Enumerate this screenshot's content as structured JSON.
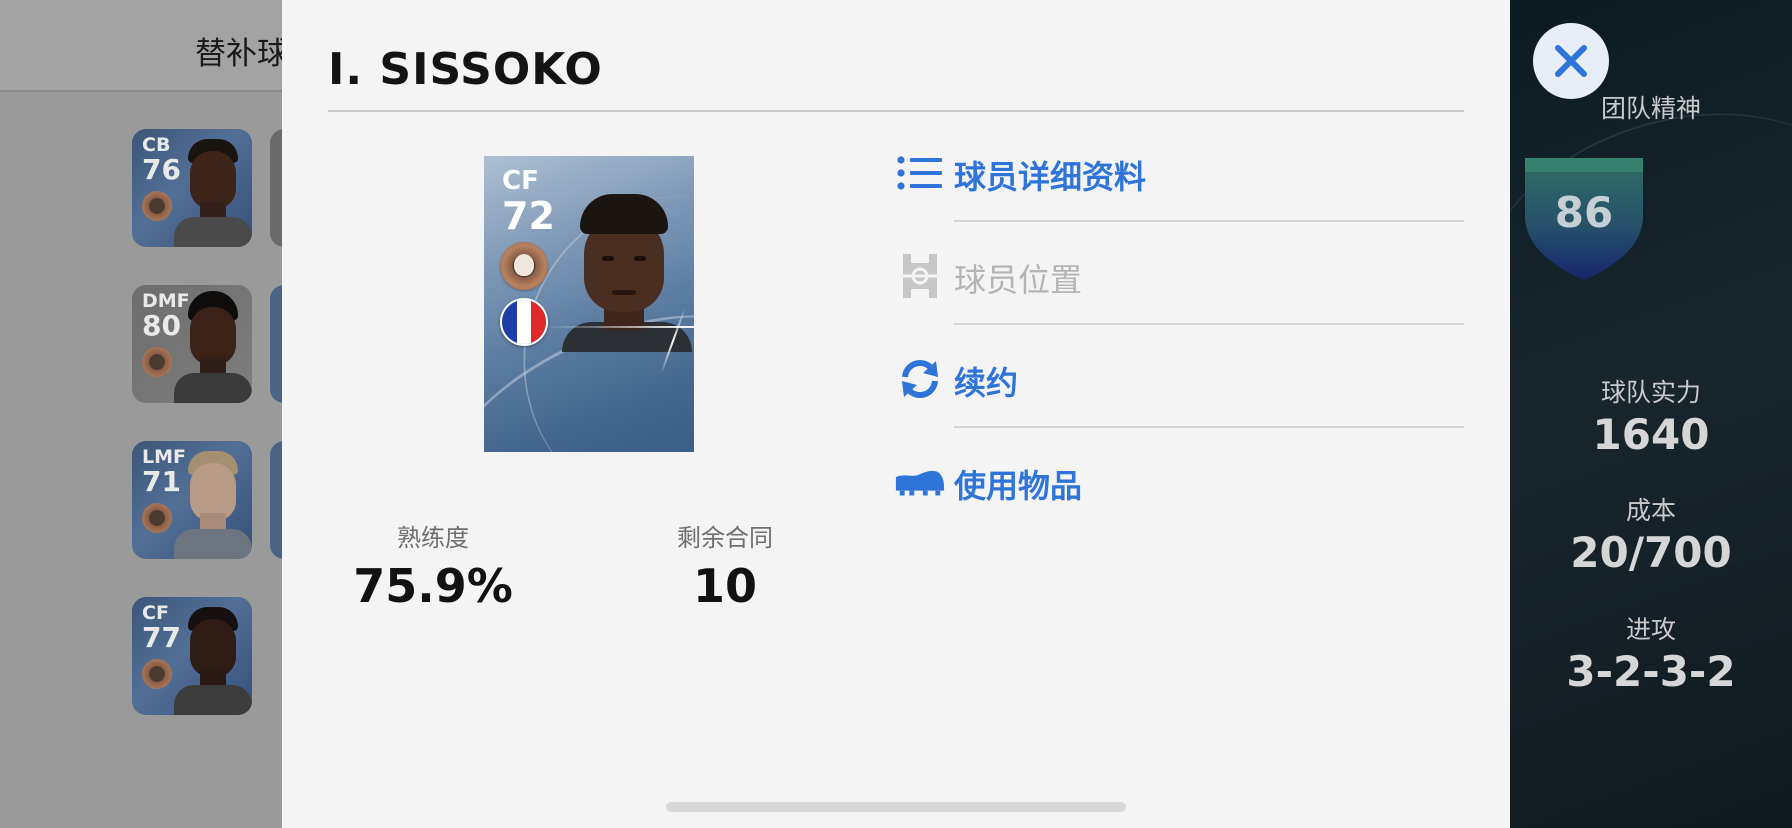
{
  "background_left": {
    "bench_title": "替补球",
    "players": [
      {
        "position": "CB",
        "rating": "76"
      },
      {
        "position": "DMF",
        "rating": "80"
      },
      {
        "position": "LMF",
        "rating": "71"
      },
      {
        "position": "CF",
        "rating": "77"
      }
    ]
  },
  "background_right": {
    "team_spirit_label": "团队精神",
    "team_spirit_value": "86",
    "team_strength_label": "球队实力",
    "team_strength_value": "1640",
    "cost_label": "成本",
    "cost_value": "20/700",
    "attack_label": "进攻",
    "attack_value": "3-2-3-2"
  },
  "modal": {
    "player_name": "I. SISSOKO",
    "card": {
      "position": "CF",
      "rating": "72",
      "nationality_flag": "France",
      "flag_colors": [
        "#1e3fa8",
        "#ffffff",
        "#e02a2a"
      ]
    },
    "stats": [
      {
        "label": "熟练度",
        "value": "75.9%"
      },
      {
        "label": "剩余合同",
        "value": "10"
      }
    ],
    "menu": [
      {
        "label": "球员详细资料",
        "icon": "list-icon",
        "enabled": true
      },
      {
        "label": "球员位置",
        "icon": "pitch-icon",
        "enabled": false
      },
      {
        "label": "续约",
        "icon": "refresh-icon",
        "enabled": true
      },
      {
        "label": "使用物品",
        "icon": "boot-icon",
        "enabled": true
      }
    ],
    "close_icon": "close-icon"
  },
  "colors": {
    "accent": "#2f74d8",
    "disabled": "#b4b4b4",
    "modal_bg": "#f4f4f4"
  }
}
